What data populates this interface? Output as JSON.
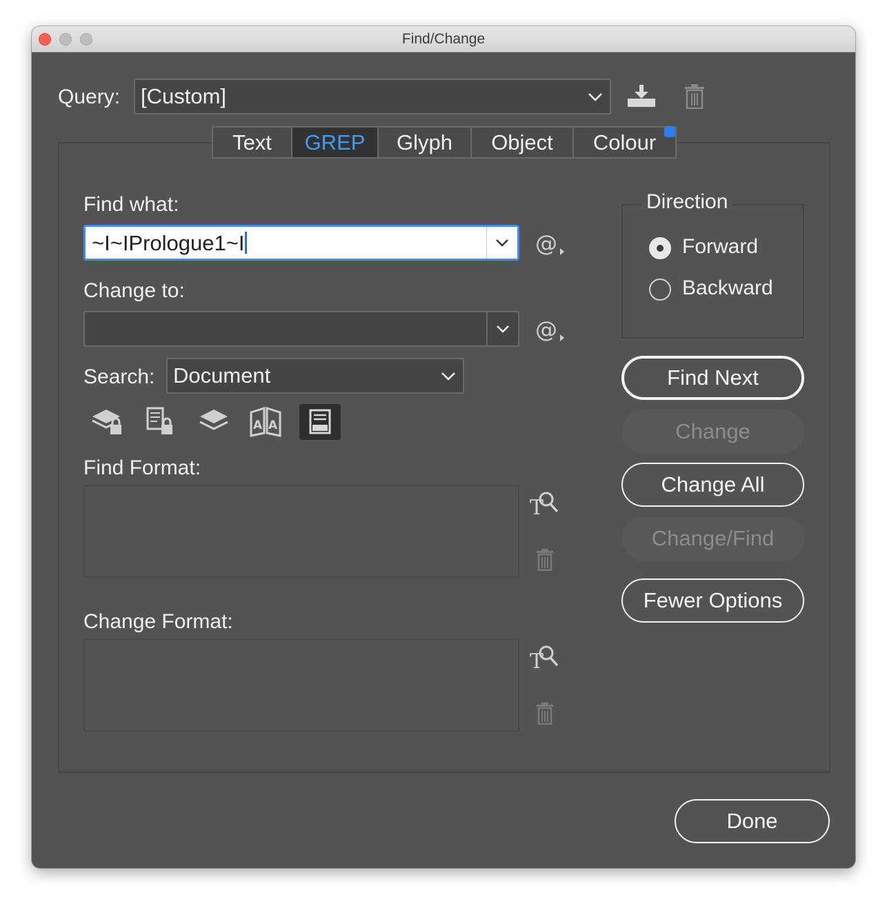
{
  "window": {
    "title": "Find/Change"
  },
  "query": {
    "label": "Query:",
    "value": "[Custom]",
    "save_icon": "save-query-icon",
    "delete_icon": "trash-icon"
  },
  "tabs": [
    {
      "label": "Text",
      "active": false
    },
    {
      "label": "GREP",
      "active": true
    },
    {
      "label": "Glyph",
      "active": false
    },
    {
      "label": "Object",
      "active": false
    },
    {
      "label": "Colour",
      "active": false
    }
  ],
  "find_what": {
    "label": "Find what:",
    "value": "~I~IPrologue1~I"
  },
  "change_to": {
    "label": "Change to:",
    "value": ""
  },
  "search": {
    "label": "Search:",
    "value": "Document"
  },
  "search_options": [
    {
      "icon": "include-locked-layers-icon",
      "active": false
    },
    {
      "icon": "include-locked-stories-icon",
      "active": false
    },
    {
      "icon": "include-hidden-layers-icon",
      "active": false
    },
    {
      "icon": "include-master-pages-icon",
      "active": false
    },
    {
      "icon": "include-footnotes-icon",
      "active": true
    }
  ],
  "find_format": {
    "label": "Find Format:"
  },
  "change_format": {
    "label": "Change Format:"
  },
  "direction": {
    "label": "Direction",
    "options": [
      {
        "label": "Forward",
        "selected": true
      },
      {
        "label": "Backward",
        "selected": false
      }
    ]
  },
  "buttons": {
    "find_next": "Find Next",
    "change": "Change",
    "change_all": "Change All",
    "change_find": "Change/Find",
    "fewer_options": "Fewer Options",
    "done": "Done"
  },
  "colors": {
    "accent": "#3e9df5",
    "focus_ring": "#3e8ef0",
    "panel_bg": "#535353",
    "notification_dot": "#2f7ff0"
  }
}
